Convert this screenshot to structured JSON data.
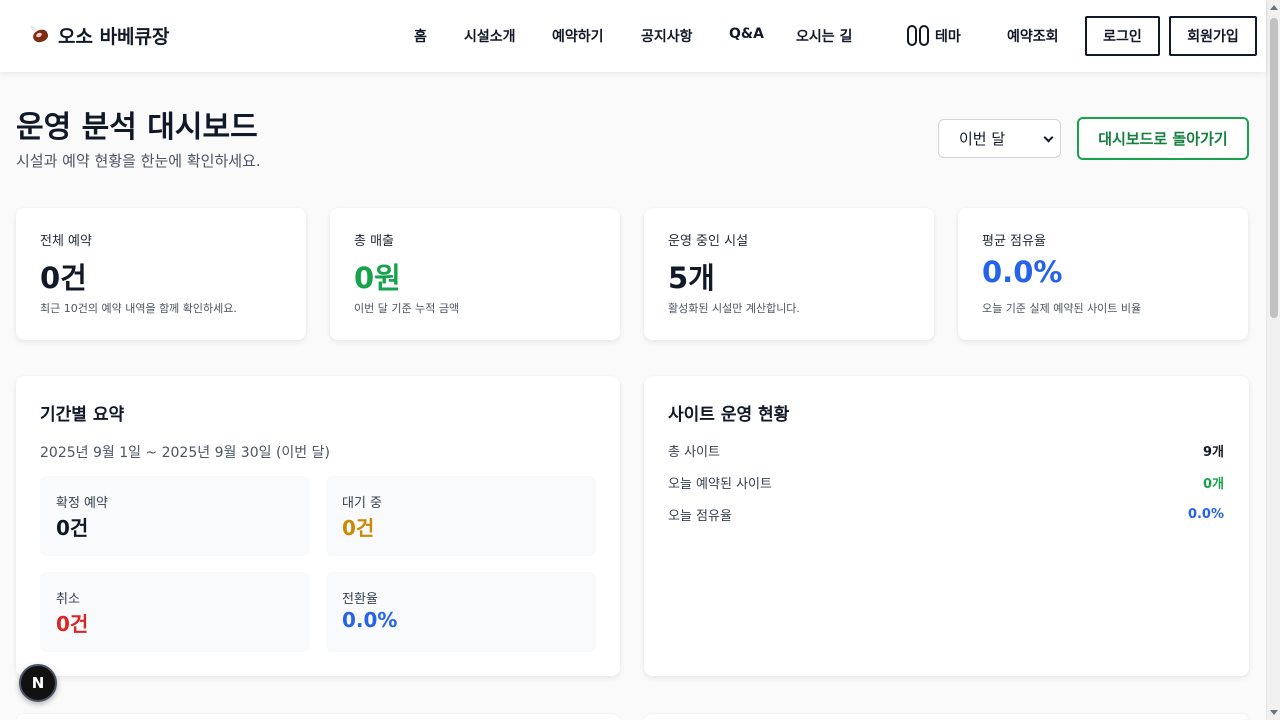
{
  "header": {
    "brand": "오소 바베큐장",
    "nav": [
      "홈",
      "시설소개",
      "예약하기",
      "공지사항",
      "Q&A",
      "오시는 길"
    ],
    "theme_label": "테마",
    "lookup": "예약조회",
    "login": "로그인",
    "signup": "회원가입"
  },
  "page": {
    "title": "운영 분석 대시보드",
    "subtitle": "시설과 예약 현황을 한눈에 확인하세요.",
    "period_selected": "이번 달",
    "back_button": "대시보드로 돌아가기"
  },
  "stats": [
    {
      "label": "전체 예약",
      "value": "0건",
      "desc": "최근 10건의 예약 내역을 함께 확인하세요.",
      "color": "#111827"
    },
    {
      "label": "총 매출",
      "value": "0원",
      "desc": "이번 달 기준 누적 금액",
      "color": "#16a34a"
    },
    {
      "label": "운영 중인 시설",
      "value": "5개",
      "desc": "활성화된 시설만 계산합니다.",
      "color": "#111827"
    },
    {
      "label": "평균 점유율",
      "value": "0.0%",
      "desc": "오늘 기준 실제 예약된 사이트 비율",
      "color": "#2563eb"
    }
  ],
  "period_summary": {
    "title": "기간별 요약",
    "range": "2025년 9월 1일 ~ 2025년 9월 30일 (이번 달)",
    "items": [
      {
        "label": "확정 예약",
        "value": "0건",
        "color": "#111827"
      },
      {
        "label": "대기 중",
        "value": "0건",
        "color": "#ca8a04"
      },
      {
        "label": "취소",
        "value": "0건",
        "color": "#dc2626"
      },
      {
        "label": "전환율",
        "value": "0.0%",
        "color": "#2563eb"
      }
    ]
  },
  "site_status": {
    "title": "사이트 운영 현황",
    "rows": [
      {
        "label": "총 사이트",
        "value": "9개",
        "color": "#111827"
      },
      {
        "label": "오늘 예약된 사이트",
        "value": "0개",
        "color": "#16a34a"
      },
      {
        "label": "오늘 점유율",
        "value": "0.0%",
        "color": "#2563eb"
      }
    ]
  },
  "dev_badge": "N"
}
